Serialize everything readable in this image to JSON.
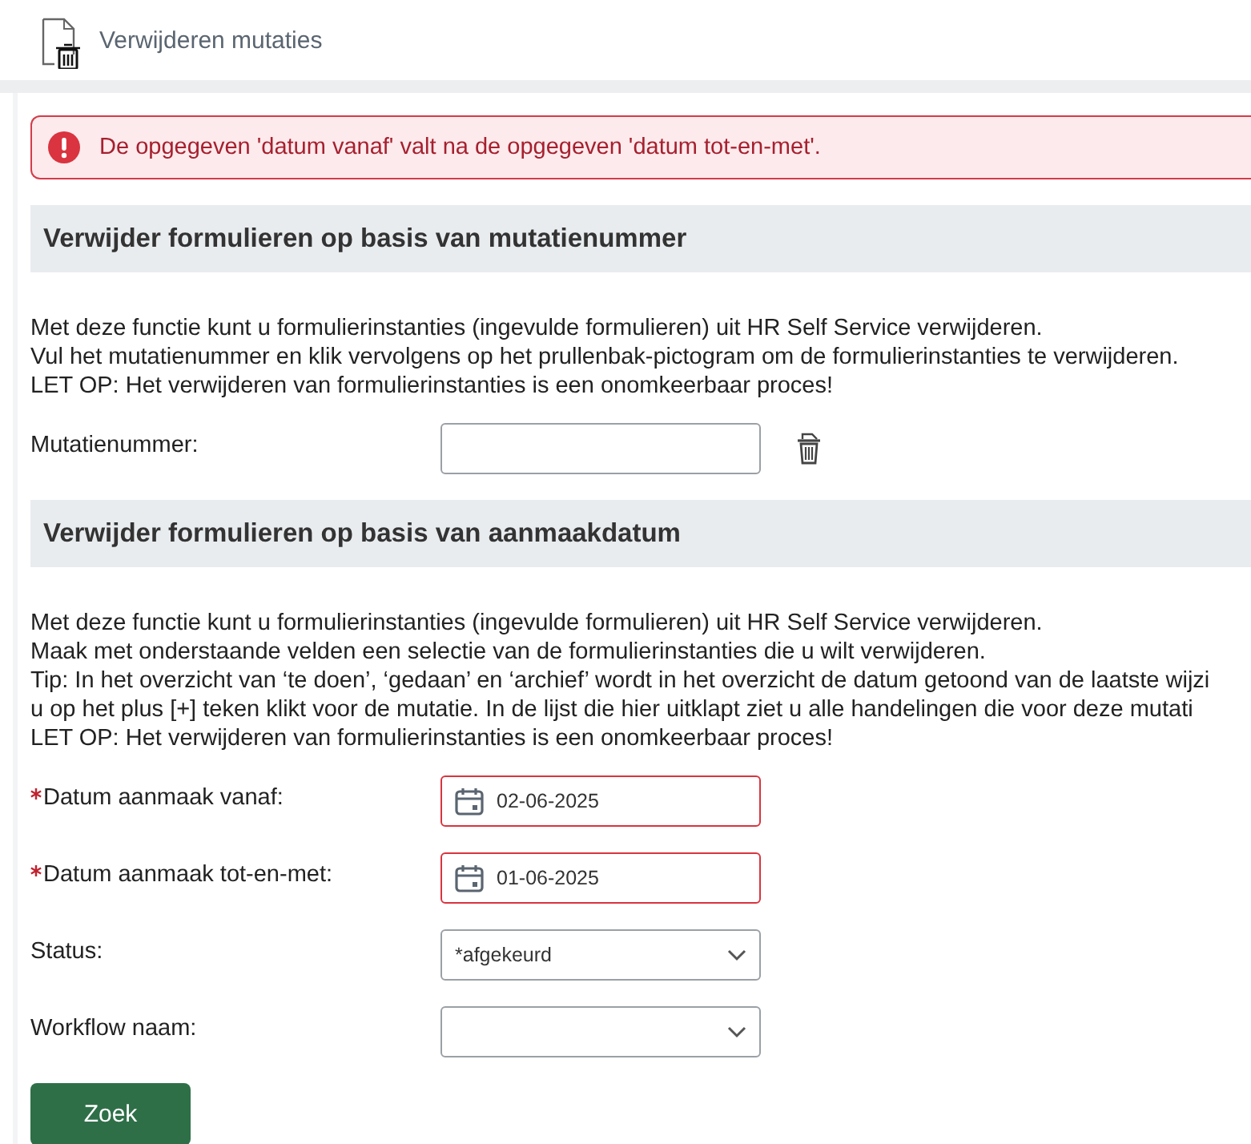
{
  "header": {
    "title": "Verwijderen mutaties"
  },
  "alert": {
    "kind": "error",
    "message": "De opgegeven 'datum vanaf' valt na de opgegeven 'datum tot-en-met'."
  },
  "sections": [
    {
      "title": "Verwijder formulieren op basis van mutatienummer",
      "paragraphs": [
        "Met deze functie kunt u formulierinstanties (ingevulde formulieren) uit HR Self Service verwijderen.",
        "Vul het mutatienummer en klik vervolgens op het prullenbak-pictogram om de formulierinstanties te verwijderen.",
        "LET OP: Het verwijderen van formulierinstanties is een onomkeerbaar proces!"
      ],
      "fields": [
        {
          "kind": "text",
          "label": "Mutatienummer:",
          "required": false,
          "invalid": false,
          "delete_button": true
        }
      ]
    },
    {
      "title": "Verwijder formulieren op basis van aanmaakdatum",
      "paragraphs": [
        "Met deze functie kunt u formulierinstanties (ingevulde formulieren) uit HR Self Service verwijderen.",
        "Maak met onderstaande velden een selectie van de formulierinstanties die u wilt verwijderen.",
        "Tip: In het overzicht van ‘te doen’, ‘gedaan’ en ‘archief’ wordt in het overzicht de datum getoond van de laatste wijzi",
        "u op het plus [+] teken klikt voor de mutatie. In de lijst die hier uitklapt ziet u alle handelingen die voor deze mutati",
        "LET OP: Het verwijderen van formulierinstanties is een onomkeerbaar proces!"
      ],
      "fields": [
        {
          "kind": "date",
          "label": "Datum aanmaak vanaf:",
          "required": true,
          "invalid": true,
          "value": "02-06-2025"
        },
        {
          "kind": "date",
          "label": "Datum aanmaak tot-en-met:",
          "required": true,
          "invalid": true,
          "value": "01-06-2025"
        },
        {
          "kind": "select",
          "label": "Status:",
          "required": false,
          "invalid": false,
          "value": "*afgekeurd"
        },
        {
          "kind": "select",
          "label": "Workflow naam:",
          "required": false,
          "invalid": false
        }
      ],
      "button": "Zoek"
    }
  ]
}
